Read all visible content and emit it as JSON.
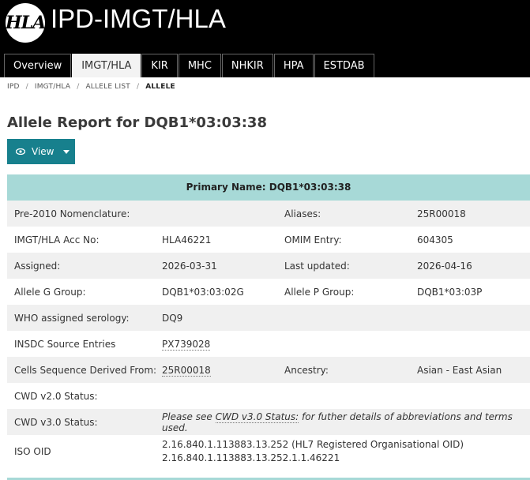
{
  "site": {
    "logo_text": "HLA",
    "title": "IPD-IMGT/HLA"
  },
  "nav": {
    "tabs": [
      {
        "label": "Overview",
        "active": false
      },
      {
        "label": "IMGT/HLA",
        "active": true
      },
      {
        "label": "KIR",
        "active": false
      },
      {
        "label": "MHC",
        "active": false
      },
      {
        "label": "NHKIR",
        "active": false
      },
      {
        "label": "HPA",
        "active": false
      },
      {
        "label": "ESTDAB",
        "active": false
      }
    ]
  },
  "breadcrumb": {
    "items": [
      "IPD",
      "IMGT/HLA",
      "ALLELE LIST",
      "ALLELE"
    ],
    "separator": "/"
  },
  "page": {
    "title": "Allele Report for DQB1*03:03:38",
    "view_label": "View"
  },
  "report": {
    "header": "Primary Name: DQB1*03:03:38",
    "rows": {
      "pre2010": {
        "label": "Pre-2010 Nomenclature:",
        "value": "",
        "label2": "Aliases:",
        "value2": "25R00018"
      },
      "acc": {
        "label": "IMGT/HLA Acc No:",
        "value": "HLA46221",
        "label2": "OMIM Entry:",
        "value2": "604305"
      },
      "assigned": {
        "label": "Assigned:",
        "value": "2026-03-31",
        "label2": "Last updated:",
        "value2": "2026-04-16"
      },
      "group": {
        "label": "Allele G Group:",
        "value": "DQB1*03:03:02G",
        "label2": "Allele P Group:",
        "value2": "DQB1*03:03P"
      },
      "who": {
        "label": "WHO assigned serology:",
        "value": "DQ9"
      },
      "insdc": {
        "label": "INSDC Source Entries",
        "value": "PX739028"
      },
      "cells": {
        "label": "Cells Sequence Derived From:",
        "value": "25R00018",
        "label2": "Ancestry:",
        "value2": "Asian - East Asian"
      },
      "cwd2": {
        "label": "CWD v2.0 Status:",
        "value": ""
      },
      "cwd3": {
        "label": "CWD v3.0 Status:",
        "prefix": "Please see ",
        "link": "CWD v3.0 Status:",
        "suffix": " for futher details of abbreviations and terms used."
      },
      "iso": {
        "label": "ISO OID",
        "line1": "2.16.840.1.113883.13.252 (HL7 Registered Organisational OID)",
        "line2": "2.16.840.1.113883.13.252.1.1.46221"
      }
    }
  },
  "colors": {
    "topbar": "#000000",
    "accent": "#17808d",
    "header_bg": "#a7d9d7",
    "row_alt": "#f0f0f0"
  }
}
